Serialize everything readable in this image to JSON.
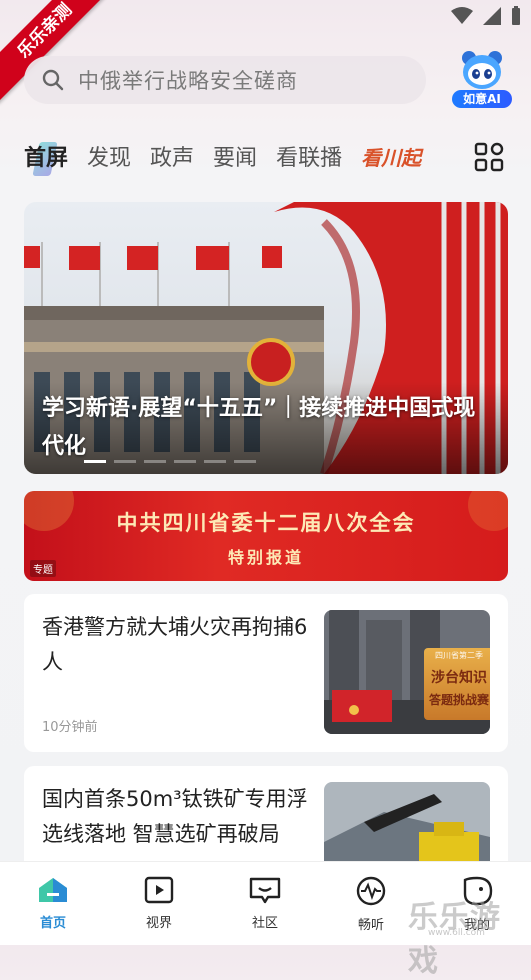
{
  "corner_badge": "乐乐亲测",
  "search": {
    "placeholder": "中俄举行战略安全磋商",
    "ai_label": "如意AI"
  },
  "tabs": [
    {
      "label": "首屏",
      "active": true
    },
    {
      "label": "发现"
    },
    {
      "label": "政声"
    },
    {
      "label": "要闻"
    },
    {
      "label": "看联播"
    },
    {
      "label": "看川起"
    }
  ],
  "hero": {
    "caption": "学习新语·展望“十五五”｜接续推进中国式现代化",
    "slides": 6,
    "active_slide": 1
  },
  "banner": {
    "title": "中共四川省委十二届八次全会",
    "subtitle": "特别报道",
    "tag": "专题"
  },
  "news": [
    {
      "title": "香港警方就大埔火灾再拘捕6人",
      "meta": "10分钟前",
      "overlay_small": "四川省第二季",
      "overlay_line1": "涉台知识",
      "overlay_line2": "答题挑战赛"
    },
    {
      "title": "国内首条50m³钛铁矿专用浮选线落地 智慧选矿再破局",
      "meta": ""
    }
  ],
  "bottom_nav": [
    {
      "label": "首页",
      "icon": "home-icon",
      "active": true
    },
    {
      "label": "视界",
      "icon": "play-icon"
    },
    {
      "label": "社区",
      "icon": "chat-icon"
    },
    {
      "label": "畅听",
      "icon": "audio-wave-icon"
    },
    {
      "label": "我的",
      "icon": "user-icon"
    }
  ],
  "watermark": {
    "text": "乐乐游戏",
    "url": "www.6ll.com"
  },
  "colors": {
    "accent_red": "#d0021b",
    "nav_active": "#2a8cd4"
  }
}
